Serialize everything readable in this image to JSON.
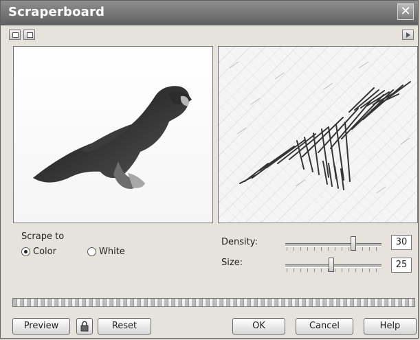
{
  "window": {
    "title": "Scraperboard",
    "close_label": "✕"
  },
  "icons": {
    "close": "close-icon",
    "toolbar_left": "window-icon",
    "toolbar_second": "window-icon",
    "toolbar_right": "play-icon",
    "lock": "lock-icon"
  },
  "controls": {
    "scrape_to_label": "Scrape to",
    "color_label": "Color",
    "white_label": "White",
    "selected_mode": "Color",
    "density_label": "Density:",
    "density_value": "30",
    "density_level": 0.72,
    "size_label": "Size:",
    "size_value": "25",
    "size_level": 0.48
  },
  "buttons": {
    "preview": "Preview",
    "reset": "Reset",
    "ok": "OK",
    "cancel": "Cancel",
    "help": "Help"
  },
  "colors": {
    "title_bar": "#6f6f6f",
    "panel_border": "#777777"
  }
}
